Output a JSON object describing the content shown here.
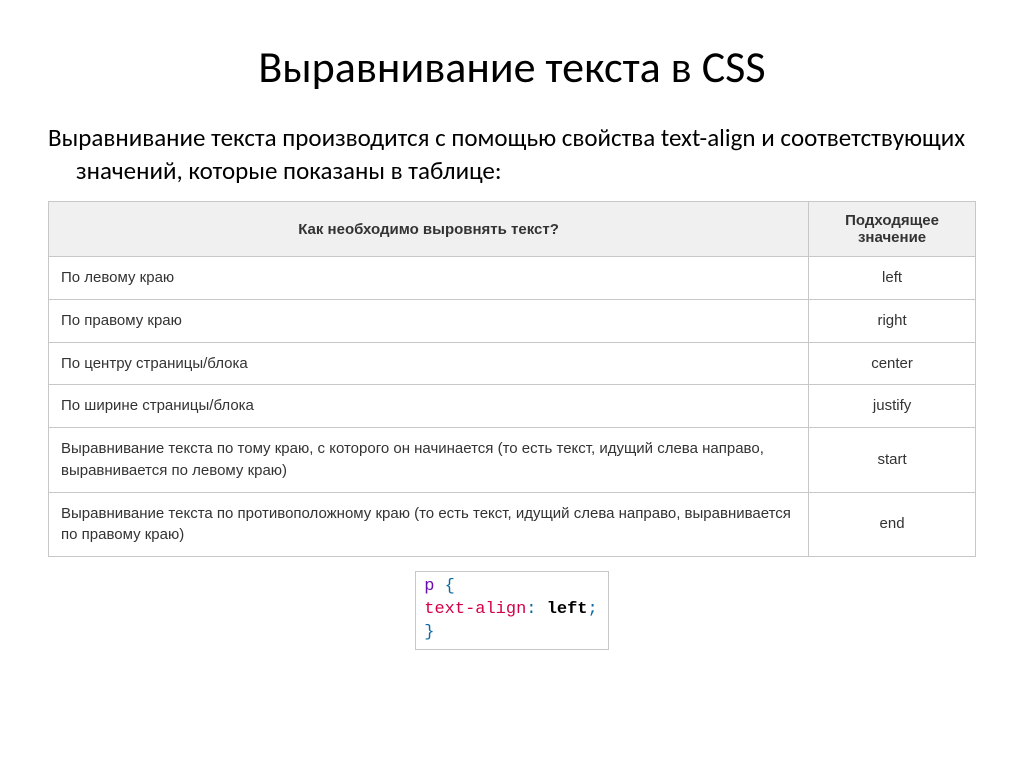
{
  "title": "Выравнивание текста в CSS",
  "description": "Выравнивание текста производится с помощью свойства text-align и соответствующих значений, которые показаны в таблице:",
  "table": {
    "header_desc": "Как необходимо выровнять текст?",
    "header_val": "Подходящее значение",
    "rows": [
      {
        "desc": "По левому краю",
        "val": "left"
      },
      {
        "desc": "По правому краю",
        "val": "right"
      },
      {
        "desc": "По центру страницы/блока",
        "val": "center"
      },
      {
        "desc": "По ширине страницы/блока",
        "val": "justify"
      },
      {
        "desc": "Выравнивание текста по тому краю, с которого он начинается (то есть текст, идущий слева направо, выравнивается по левому краю)",
        "val": "start"
      },
      {
        "desc": "Выравнивание текста по противоположному краю (то есть текст, идущий слева направо, выравнивается по правому краю)",
        "val": "end"
      }
    ]
  },
  "code": {
    "selector": "p",
    "open": "{",
    "prop": "text-align",
    "colon": ":",
    "value": "left",
    "semi": ";",
    "close": "}"
  }
}
